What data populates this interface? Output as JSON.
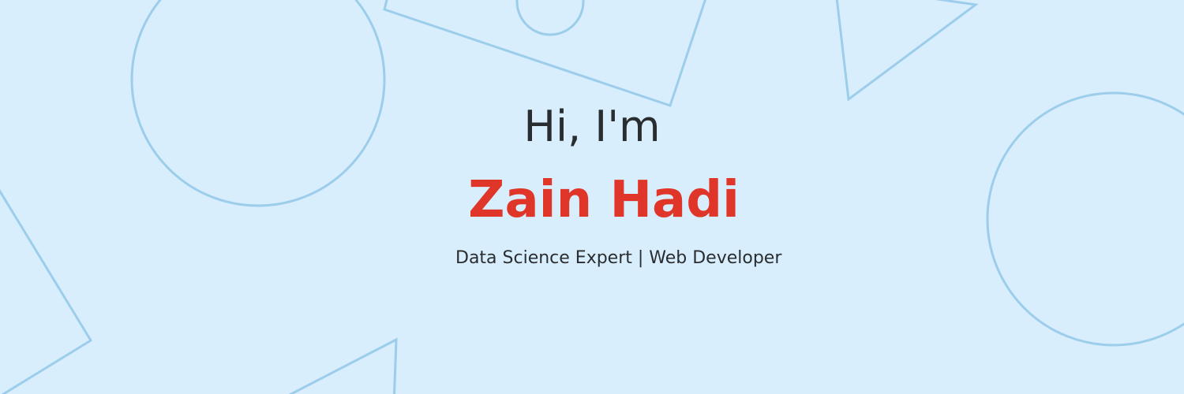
{
  "hero": {
    "greeting": "Hi, I'm",
    "name": "Zain Hadi",
    "tagline": "Data Science Expert | Web Developer"
  },
  "colors": {
    "background": "#d9eefd",
    "shape_stroke": "#9ccdea",
    "name_accent": "#e0362a",
    "text": "#2a2d30"
  }
}
